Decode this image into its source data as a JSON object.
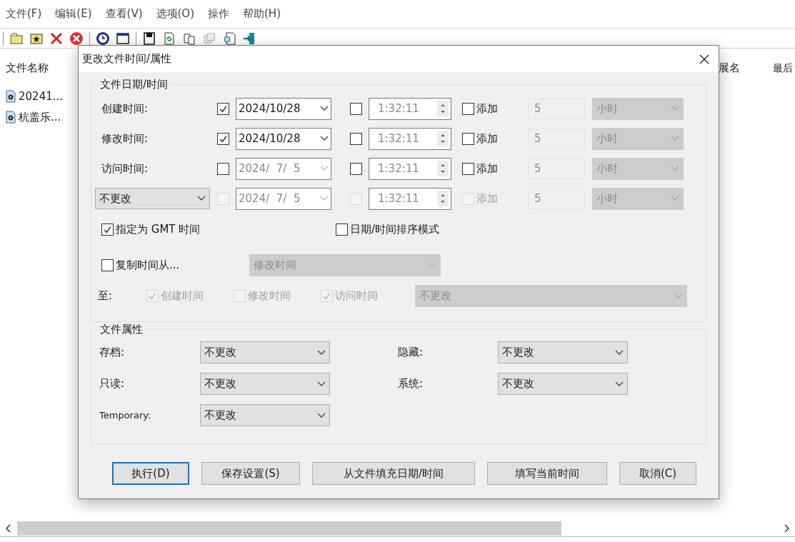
{
  "menu": [
    "文件(F)",
    "编辑(E)",
    "查看(V)",
    "选项(O)",
    "操作",
    "帮助(H)"
  ],
  "file_list": {
    "columns": [
      "文件名称",
      "展名",
      "最后"
    ],
    "rows": [
      "20241...",
      "杭盖乐..."
    ]
  },
  "dialog": {
    "title": "更改文件时间/属性",
    "date_time": {
      "title": "文件日期/时间",
      "rows": [
        {
          "kind": "label",
          "label": "创建时间:",
          "disabled": false,
          "date": {
            "checked": true,
            "value": "2024/10/28",
            "disabled": false
          },
          "time": {
            "checked": false,
            "value": "1:32:11"
          },
          "add": {
            "label": "添加",
            "checked": false
          },
          "amount": "5",
          "unit": "小时"
        },
        {
          "kind": "label",
          "label": "修改时间:",
          "disabled": false,
          "date": {
            "checked": true,
            "value": "2024/10/28",
            "disabled": false
          },
          "time": {
            "checked": false,
            "value": "1:32:11"
          },
          "add": {
            "label": "添加",
            "checked": false
          },
          "amount": "5",
          "unit": "小时"
        },
        {
          "kind": "label",
          "label": "访问时间:",
          "disabled": false,
          "date": {
            "checked": false,
            "value": "2024/  7/  5",
            "disabled": true
          },
          "time": {
            "checked": false,
            "value": "1:32:11"
          },
          "add": {
            "label": "添加",
            "checked": false
          },
          "amount": "5",
          "unit": "小时"
        },
        {
          "kind": "select",
          "label": "不更改",
          "disabled": true,
          "date": {
            "checked": false,
            "value": "2024/  7/  5",
            "disabled": true
          },
          "time": {
            "checked": false,
            "value": "1:32:11"
          },
          "add": {
            "label": "添加",
            "checked": false
          },
          "amount": "5",
          "unit": "小时"
        }
      ],
      "options": [
        {
          "label": "指定为 GMT 时间",
          "checked": true
        },
        {
          "label": "日期/时间排序模式",
          "checked": false
        }
      ],
      "copy_from": {
        "label": "复制时间从...",
        "checked": false,
        "value": "修改时间"
      },
      "to": {
        "label": "至:",
        "targets": [
          {
            "label": "创建时间",
            "checked": true
          },
          {
            "label": "修改时间",
            "checked": false
          },
          {
            "label": "访问时间",
            "checked": true
          }
        ],
        "value": "不更改"
      }
    },
    "attributes": {
      "title": "文件属性",
      "fields": [
        {
          "label": "存档:",
          "value": "不更改"
        },
        {
          "label": "隐藏:",
          "value": "不更改"
        },
        {
          "label": "只读:",
          "value": "不更改"
        },
        {
          "label": "系统:",
          "value": "不更改"
        },
        {
          "label": "Temporary:",
          "value": "不更改"
        }
      ]
    },
    "buttons": [
      {
        "label": "执行(D)",
        "default": true
      },
      {
        "label": "保存设置(S)",
        "default": false
      },
      {
        "label": "从文件填充日期/时间",
        "default": false
      },
      {
        "label": "填写当前时间",
        "default": false
      },
      {
        "label": "取消(C)",
        "default": false
      }
    ]
  }
}
